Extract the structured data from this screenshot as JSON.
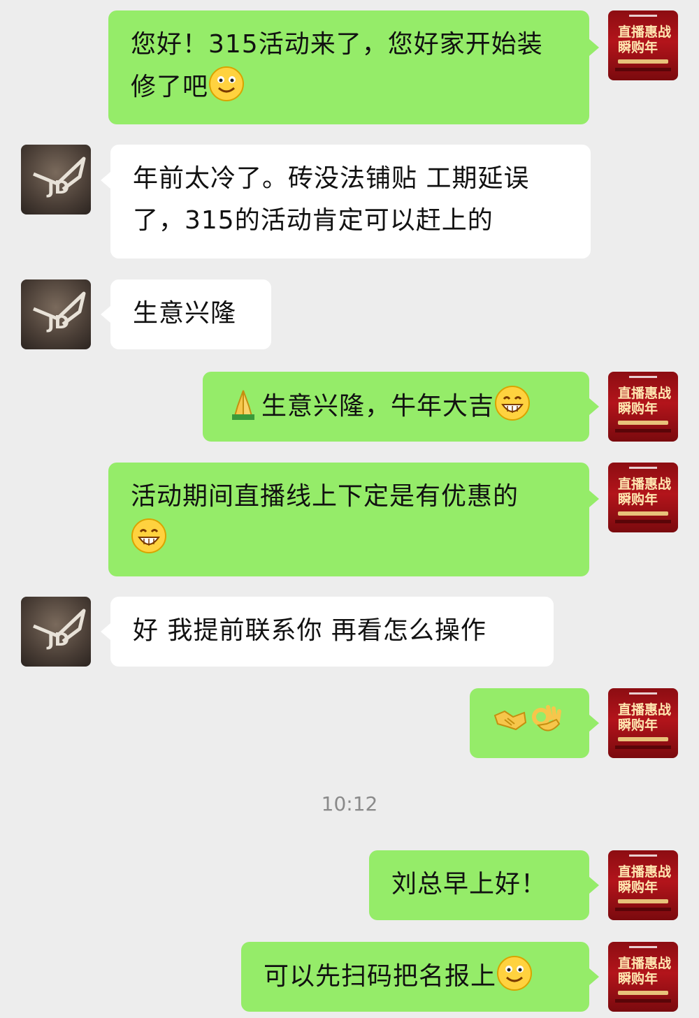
{
  "avatars": {
    "store": {
      "line1": "直播惠战",
      "line2": "瞬购年"
    },
    "customer": {
      "logo_text": "JD"
    }
  },
  "messages": [
    {
      "side": "out",
      "text": "您好！315活动来了，您好家开始装修了吧",
      "emoji": "smile-emoji"
    },
    {
      "side": "in",
      "text": "年前太冷了。砖没法铺贴 工期延误了，315的活动肯定可以赶上的"
    },
    {
      "side": "in",
      "text": "生意兴隆"
    },
    {
      "side": "out",
      "text": "生意兴隆，牛年大吉",
      "emoji_before": "pray-emoji",
      "emoji": "grin-emoji"
    },
    {
      "side": "out",
      "text": "活动期间直播线上下定是有优惠的",
      "emoji": "grin-emoji"
    },
    {
      "side": "in",
      "text": "好 我提前联系你 再看怎么操作"
    },
    {
      "side": "out",
      "text": "",
      "emoji_before": "handshake-emoji",
      "emoji": "ok-hand-emoji"
    },
    {
      "side": "out",
      "text": "刘总早上好！"
    },
    {
      "side": "out",
      "text": "可以先扫码把名报上",
      "emoji": "smile-emoji"
    }
  ],
  "timestamp": "10:12",
  "colors": {
    "background": "#ededed",
    "outgoing_bubble": "#95ec69",
    "incoming_bubble": "#ffffff"
  }
}
